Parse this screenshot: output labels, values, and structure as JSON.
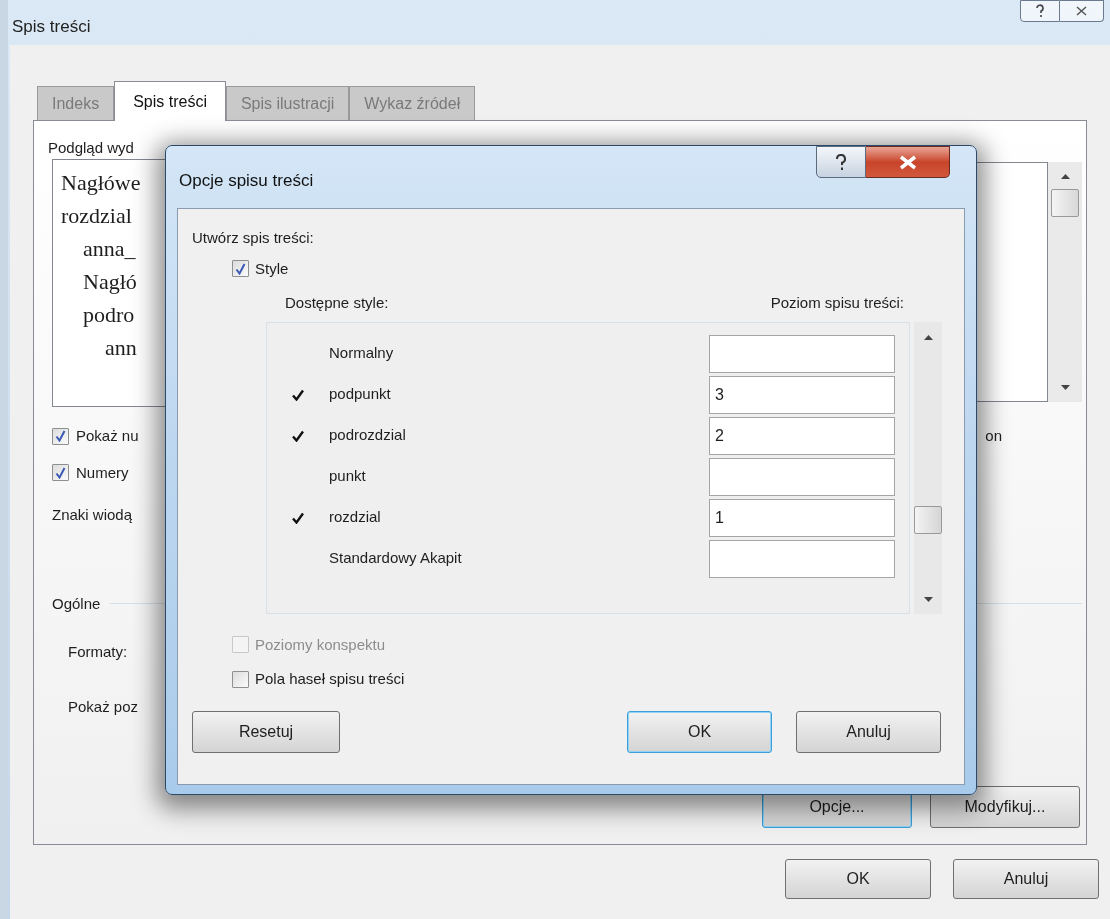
{
  "window": {
    "title": "Spis treści"
  },
  "tabs": [
    {
      "label": "Indeks",
      "selected": false
    },
    {
      "label": "Spis treści",
      "selected": true
    },
    {
      "label": "Spis ilustracji",
      "selected": false
    },
    {
      "label": "Wykaz źródeł",
      "selected": false
    }
  ],
  "print_preview": {
    "label": "Podgląd wyd",
    "lines": [
      {
        "text": "Nagłówe"
      },
      {
        "text": "rozdzial",
        "children": [
          {
            "text": "anna_"
          },
          {
            "text": "Nagłó"
          },
          {
            "text": "podro",
            "children": [
              {
                "text": "ann"
              }
            ]
          }
        ]
      }
    ]
  },
  "checkboxes": [
    {
      "label": "Pokaż nu",
      "checked": true,
      "trailing": "on"
    },
    {
      "label": "Numery",
      "checked": true
    }
  ],
  "leader_label": "Znaki wiodą",
  "general": {
    "title": "Ogólne",
    "formats_label": "Formaty:",
    "levels_label": "Pokaż poz"
  },
  "panel_buttons": [
    {
      "label": "Opcje...",
      "focused": true
    },
    {
      "label": "Modyfikuj...",
      "focused": false
    }
  ],
  "buttons": [
    {
      "label": "OK"
    },
    {
      "label": "Anuluj"
    }
  ],
  "options_dialog": {
    "title": "Opcje spisu treści",
    "section_label": "Utwórz spis treści:",
    "style_checkbox": {
      "label": "Style",
      "checked": true
    },
    "columns": [
      "Dostępne style:",
      "Poziom spisu treści:"
    ],
    "styles": [
      {
        "name": "Normalny",
        "in_toc": false
      },
      {
        "name": "podpunkt",
        "in_toc": true,
        "level": "3"
      },
      {
        "name": "podrozdzial",
        "in_toc": true,
        "level": "2"
      },
      {
        "name": "punkt",
        "in_toc": false
      },
      {
        "name": "rozdzial",
        "in_toc": true,
        "level": "1"
      },
      {
        "name": "Standardowy Akapit",
        "in_toc": false
      }
    ],
    "options": [
      {
        "label": "Poziomy konspektu",
        "checked": false,
        "disabled": true
      },
      {
        "label": "Pola haseł spisu treści",
        "checked": false,
        "disabled": false
      }
    ],
    "reset_button": "Resetuj",
    "buttons": [
      {
        "label": "OK",
        "focused": true
      },
      {
        "label": "Anuluj",
        "focused": false
      }
    ]
  }
}
